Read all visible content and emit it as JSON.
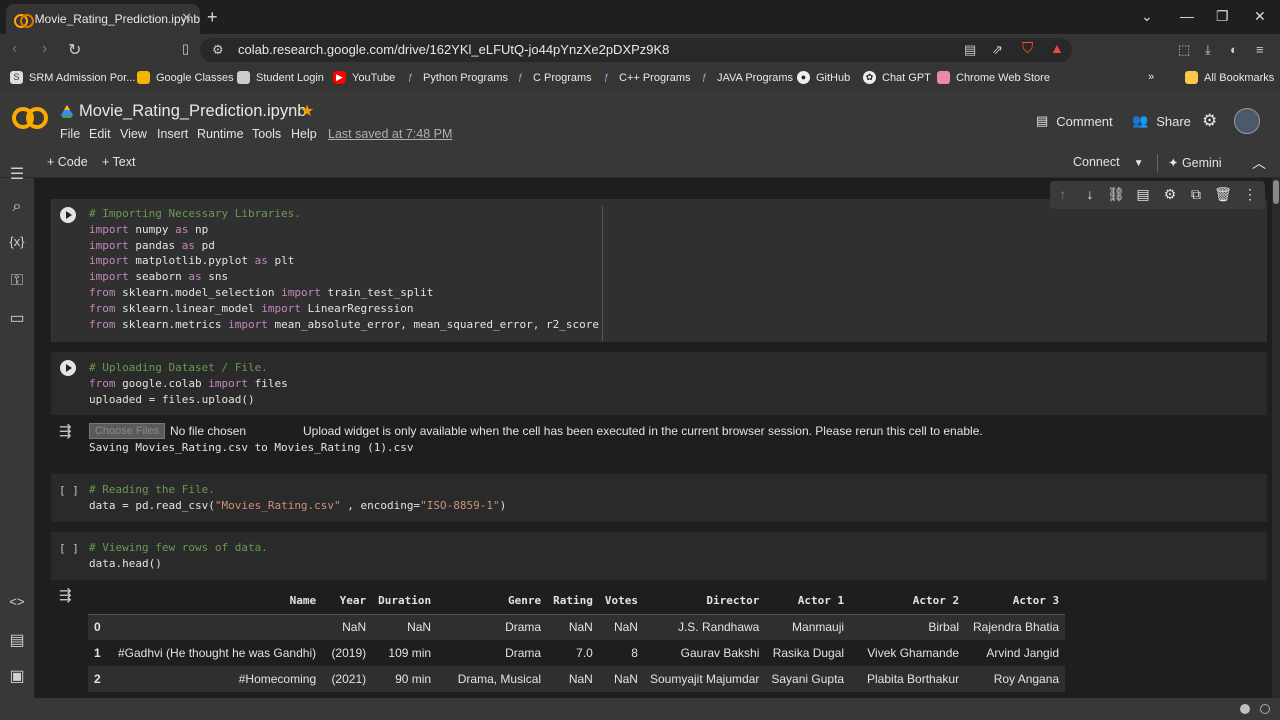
{
  "browser": {
    "tab_title": "Movie_Rating_Prediction.ipynb",
    "url": "colab.research.google.com/drive/162YKl_eLFUtQ-jo44pYnzXe2pDXPz9K8",
    "bookmarks": [
      "SRM Admission Por...",
      "Google Classes",
      "Student Login",
      "YouTube",
      "Python Programs",
      "C Programs",
      "C++ Programs",
      "JAVA Programs",
      "GitHub",
      "Chat GPT",
      "Chrome Web Store"
    ],
    "all_bookmarks": "All Bookmarks"
  },
  "colab": {
    "notebook_title": "Movie_Rating_Prediction.ipynb",
    "menu": [
      "File",
      "Edit",
      "View",
      "Insert",
      "Runtime",
      "Tools",
      "Help"
    ],
    "last_saved": "Last saved at 7:48 PM",
    "comment": "Comment",
    "share": "Share",
    "add_code": "+ Code",
    "add_text": "+ Text",
    "connect": "Connect",
    "gemini": "Gemini"
  },
  "cells": {
    "c1": [
      "# Importing Necessary Libraries.",
      "import numpy as np",
      "import pandas as pd",
      "import matplotlib.pyplot as plt",
      "import seaborn as sns",
      "from sklearn.model_selection import train_test_split",
      "from sklearn.linear_model import LinearRegression",
      "from sklearn.metrics import mean_absolute_error, mean_squared_error, r2_score"
    ],
    "c2": [
      "# Uploading Dataset / File.",
      "from google.colab import files",
      "uploaded = files.upload()"
    ],
    "c2_out": {
      "choose": "Choose Files",
      "nofile": "No file chosen",
      "message": "Upload widget is only available when the cell has been executed in the current browser session. Please rerun this cell to enable.",
      "saving": "Saving Movies_Rating.csv to Movies_Rating (1).csv"
    },
    "c3_bracket": "[ ]",
    "c3": [
      "# Reading the File.",
      "data = pd.read_csv(\"Movies_Rating.csv\" , encoding=\"ISO-8859-1\")"
    ],
    "c4_bracket": "[ ]",
    "c4": [
      "# Viewing few rows of data.",
      "data.head()"
    ]
  },
  "table": {
    "headers": [
      "",
      "Name",
      "Year",
      "Duration",
      "Genre",
      "Rating",
      "Votes",
      "Director",
      "Actor 1",
      "Actor 2",
      "Actor 3"
    ],
    "rows": [
      [
        "0",
        "",
        "NaN",
        "NaN",
        "Drama",
        "NaN",
        "NaN",
        "J.S. Randhawa",
        "Manmauji",
        "Birbal",
        "Rajendra Bhatia"
      ],
      [
        "1",
        "#Gadhvi (He thought he was Gandhi)",
        "(2019)",
        "109 min",
        "Drama",
        "7.0",
        "8",
        "Gaurav Bakshi",
        "Rasika Dugal",
        "Vivek Ghamande",
        "Arvind Jangid"
      ],
      [
        "2",
        "#Homecoming",
        "(2021)",
        "90 min",
        "Drama, Musical",
        "NaN",
        "NaN",
        "Soumyajit Majumdar",
        "Sayani Gupta",
        "Plabita Borthakur",
        "Roy Angana"
      ]
    ]
  }
}
